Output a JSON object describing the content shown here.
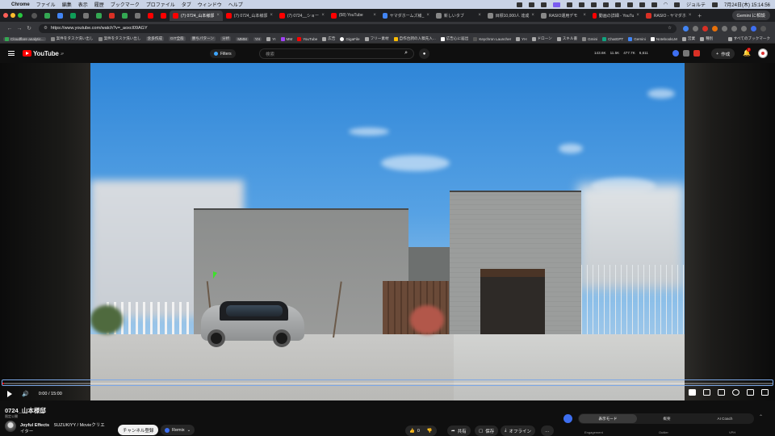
{
  "menubar": {
    "app": "Chrome",
    "items": [
      "ファイル",
      "編集",
      "表示",
      "履歴",
      "ブックマーク",
      "プロファイル",
      "タブ",
      "ウィンドウ",
      "ヘルプ"
    ],
    "user": "ジョルテ",
    "clock": "7月24日(木) 15:14:56"
  },
  "tabs": [
    {
      "label": "(7) 0724_山本様邸",
      "active": true,
      "color": "#ff0000"
    },
    {
      "label": "(7) 0724_山本様邸",
      "active": false,
      "color": "#ff0000"
    },
    {
      "label": "(7) 0724__ショー",
      "active": false,
      "color": "#ff0000"
    },
    {
      "label": "(58) YouTube",
      "active": false,
      "color": "#ff0000"
    },
    {
      "label": "ヤマダホームズ様_",
      "active": false,
      "color": "#4285f4"
    },
    {
      "label": "新しいタブ",
      "active": false,
      "color": "#888888"
    },
    {
      "label": "目標10,000人 達成",
      "active": false,
      "color": "#888888"
    },
    {
      "label": "RASIO運用デモ",
      "active": false,
      "color": "#888888"
    },
    {
      "label": "動画の詳細 - YouTu",
      "active": false,
      "color": "#ff0000"
    },
    {
      "label": "RASIO - ヤマダホ",
      "active": false,
      "color": "#d93025"
    }
  ],
  "gemini_button": "Gemini に相談",
  "address": {
    "url": "https://www.youtube.com/watch?v=_aoxcl09AGY"
  },
  "bookmarks": [
    "Cloudflare analytic...",
    "案件をタスク洗い出し",
    "案件をタスク洗い出し",
    "含多作成",
    "GIT全般",
    "勝ちパターン",
    "分析",
    "MMM",
    "YH",
    "YI",
    "MM",
    "YouTube",
    "広告",
    "GigaFile",
    "フリー素材",
    "自作台詞の入稿先入...",
    "広告心に届出",
    "Keychron Launcher",
    "YH",
    "ドローン",
    "スキル書",
    "Gmini",
    "ChatGPT",
    "Gemini",
    "NotebookLM",
    "営業",
    "種別"
  ],
  "bookmarks_all": "すべてのブックマーク",
  "youtube": {
    "logo": "YouTube",
    "region": "JP",
    "filters": "Filters",
    "search_placeholder": "検索",
    "stats": [
      "143.6K",
      "11.5K",
      "477.7K",
      "6,611"
    ],
    "create": "作成",
    "notifications": "7"
  },
  "player": {
    "current_time": "0:00",
    "duration": "15:00",
    "time_label": "0:00 / 15:00",
    "progress": 0.002
  },
  "video": {
    "title": "0724_山本様邸",
    "visibility": "限定公開",
    "channel_name": "Joyful Effects",
    "channel_desc_1": "SUZUKIYY / Movieクリエ",
    "channel_desc_2": "イター",
    "subscribe": "チャンネル登録",
    "remix": "Remix",
    "likes": "0",
    "share": "共有",
    "save": "保存",
    "offline": "オフライン",
    "more": "…"
  },
  "panel": {
    "segments": [
      "表示モード",
      "概要",
      "AI Coach"
    ],
    "sub_labels": [
      "Engagement",
      "Outlier",
      "VPH"
    ]
  },
  "colors": {
    "yt_red": "#ff0000",
    "accent_blue": "#3e6ff0",
    "bg": "#0f0f0f"
  }
}
